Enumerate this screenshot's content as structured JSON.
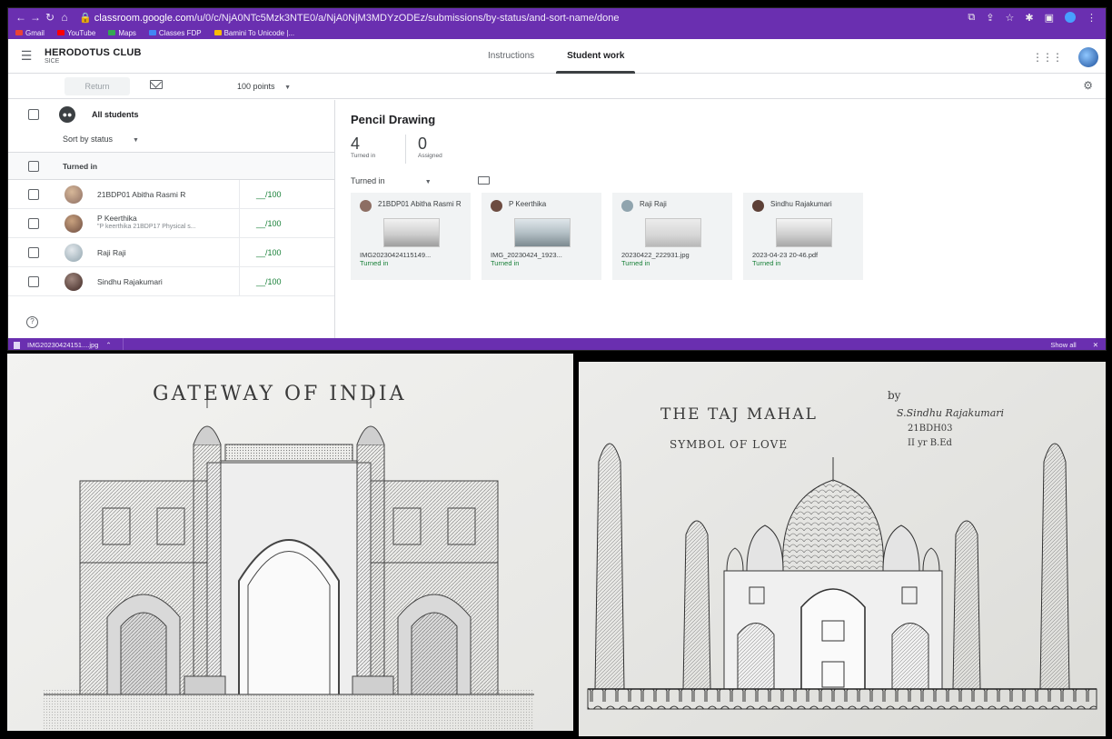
{
  "browser": {
    "url_host": "classroom.google.com",
    "url_path": "/u/0/c/NjA0NTc5Mzk3NTE0/a/NjA0NjM3MDYzODEz/submissions/by-status/and-sort-name/done",
    "bookmarks": [
      {
        "label": "Gmail",
        "color": "#ea4335"
      },
      {
        "label": "YouTube",
        "color": "#ff0000"
      },
      {
        "label": "Maps",
        "color": "#34a853"
      },
      {
        "label": "Classes FDP",
        "color": "#4285f4"
      },
      {
        "label": "Bamini To Unicode |...",
        "color": "#fbbc04"
      }
    ]
  },
  "header": {
    "class_name": "HERODOTUS CLUB",
    "class_section": "SICE",
    "tabs": [
      {
        "label": "Instructions",
        "active": false
      },
      {
        "label": "Student work",
        "active": true
      }
    ]
  },
  "toolbar": {
    "return_label": "Return",
    "points_label": "100 points"
  },
  "left_panel": {
    "all_students_label": "All students",
    "sort_label": "Sort by status",
    "group_label": "Turned in",
    "students": [
      {
        "name": "21BDP01 Abitha Rasmi R",
        "sub": "",
        "grade": "__/100",
        "avatar_color": "#8d6e63"
      },
      {
        "name": "P Keerthika",
        "sub": "\"P keerthika 21BDP17 Physical s...",
        "grade": "__/100",
        "avatar_color": "#6d4c41"
      },
      {
        "name": "Raji Raji",
        "sub": "",
        "grade": "__/100",
        "avatar_color": "#90a4ae"
      },
      {
        "name": "Sindhu Rajakumari",
        "sub": "",
        "grade": "__/100",
        "avatar_color": "#5d4037"
      }
    ]
  },
  "right_panel": {
    "assignment_title": "Pencil Drawing",
    "turned_in_count": "4",
    "turned_in_label": "Turned in",
    "assigned_count": "0",
    "assigned_label": "Assigned",
    "filter_label": "Turned in",
    "cards": [
      {
        "name": "21BDP01 Abitha Rasmi R",
        "file": "IMG20230424115149...",
        "status": "Turned in",
        "avatar_color": "#8d6e63"
      },
      {
        "name": "P Keerthika",
        "file": "IMG_20230424_1923...",
        "status": "Turned in",
        "avatar_color": "#6d4c41"
      },
      {
        "name": "Raji Raji",
        "file": "20230422_222931.jpg",
        "status": "Turned in",
        "avatar_color": "#90a4ae"
      },
      {
        "name": "Sindhu Rajakumari",
        "file": "2023-04-23 20-46.pdf",
        "status": "Turned in",
        "avatar_color": "#5d4037"
      }
    ]
  },
  "download_bar": {
    "file": "IMG20230424151....jpg",
    "show_all": "Show all"
  },
  "drawing_left": {
    "title": "GATEWAY OF INDIA"
  },
  "drawing_right": {
    "title": "THE TAJ MAHAL",
    "subtitle": "SYMBOL OF LOVE",
    "by": "by",
    "artist": "S.Sindhu Rajakumari",
    "roll": "21BDH03",
    "year": "II yr B.Ed"
  },
  "colors": {
    "accent_purple": "#6a2fb0",
    "turned_in_green": "#188038"
  }
}
